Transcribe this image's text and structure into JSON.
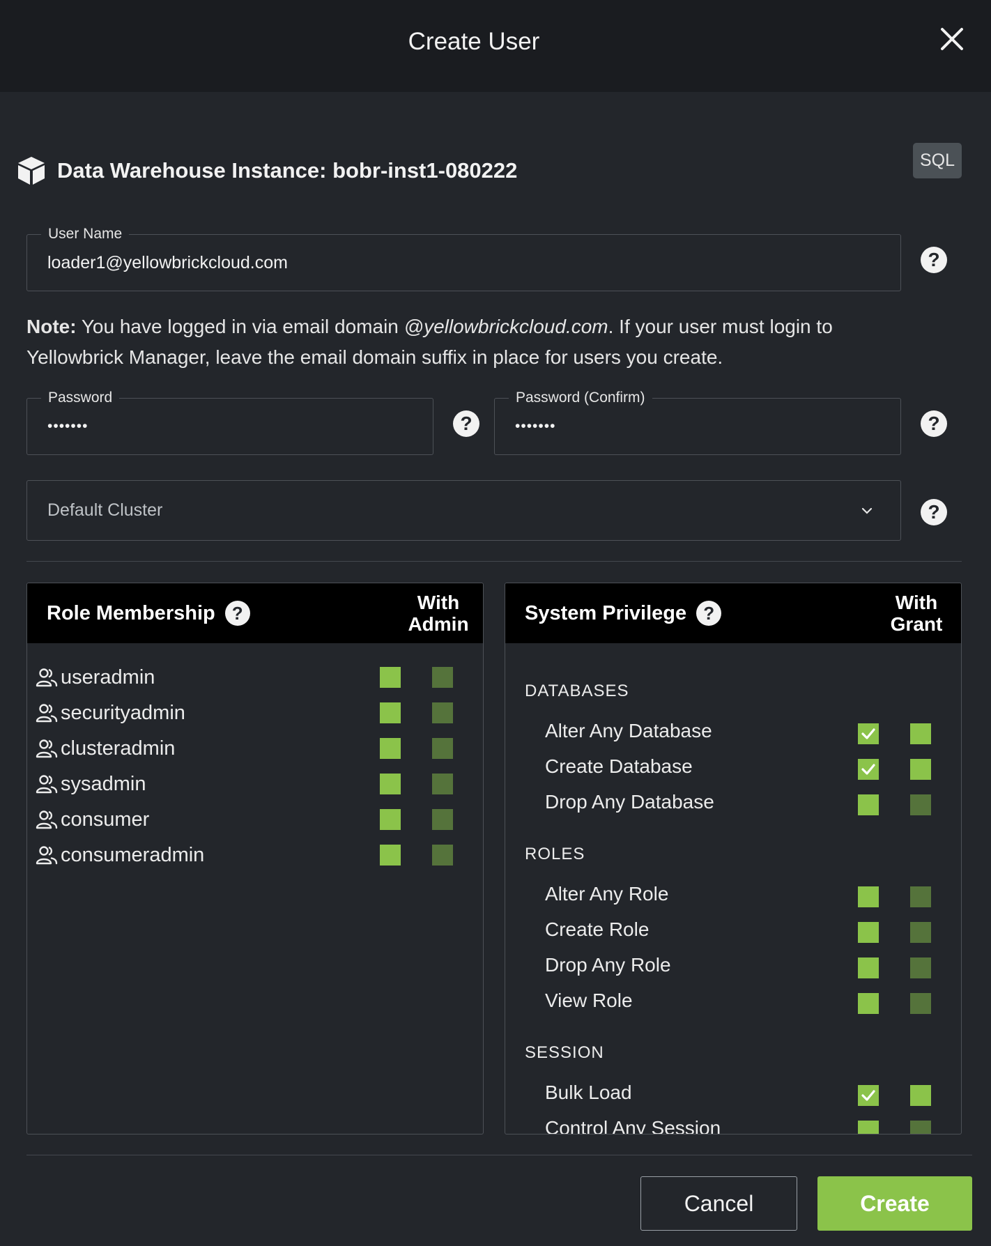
{
  "dialog": {
    "title": "Create User"
  },
  "instance": {
    "label": "Data Warehouse Instance: bobr-inst1-080222",
    "sql_button": "SQL"
  },
  "user_name": {
    "label": "User Name",
    "value": "loader1@yellowbrickcloud.com"
  },
  "note": {
    "bold": "Note:",
    "text_before": " You have logged in via email domain ",
    "domain": "@yellowbrickcloud.com",
    "text_after": ". If your user must login to Yellowbrick Manager, leave the email domain suffix in place for users you create."
  },
  "password": {
    "label": "Password",
    "value": "•••••••"
  },
  "password_confirm": {
    "label": "Password (Confirm)",
    "value": "•••••••"
  },
  "default_cluster": {
    "placeholder": "Default Cluster"
  },
  "role_membership": {
    "title": "Role Membership",
    "col_line1": "With",
    "col_line2": "Admin",
    "roles": [
      {
        "name": "useradmin",
        "member": false,
        "with_admin": false
      },
      {
        "name": "securityadmin",
        "member": false,
        "with_admin": false
      },
      {
        "name": "clusteradmin",
        "member": false,
        "with_admin": false
      },
      {
        "name": "sysadmin",
        "member": false,
        "with_admin": false
      },
      {
        "name": "consumer",
        "member": false,
        "with_admin": false
      },
      {
        "name": "consumeradmin",
        "member": false,
        "with_admin": false
      }
    ]
  },
  "system_privilege": {
    "title": "System Privilege",
    "col_line1": "With",
    "col_line2": "Grant",
    "sections": [
      {
        "name": "DATABASES",
        "items": [
          {
            "name": "Alter Any Database",
            "granted": true,
            "with_grant": false
          },
          {
            "name": "Create Database",
            "granted": true,
            "with_grant": false
          },
          {
            "name": "Drop Any Database",
            "granted": false,
            "with_grant": false
          }
        ]
      },
      {
        "name": "ROLES",
        "items": [
          {
            "name": "Alter Any Role",
            "granted": false,
            "with_grant": false
          },
          {
            "name": "Create Role",
            "granted": false,
            "with_grant": false
          },
          {
            "name": "Drop Any Role",
            "granted": false,
            "with_grant": false
          },
          {
            "name": "View Role",
            "granted": false,
            "with_grant": false
          }
        ]
      },
      {
        "name": "SESSION",
        "items": [
          {
            "name": "Bulk Load",
            "granted": true,
            "with_grant": false
          },
          {
            "name": "Control Any Session",
            "granted": false,
            "with_grant": false
          }
        ]
      }
    ]
  },
  "actions": {
    "cancel": "Cancel",
    "create": "Create"
  },
  "colors": {
    "accent": "#8bc34a",
    "accent_dim": "#55733b",
    "header_bg": "#1a1c20",
    "body_bg": "#23262b"
  }
}
